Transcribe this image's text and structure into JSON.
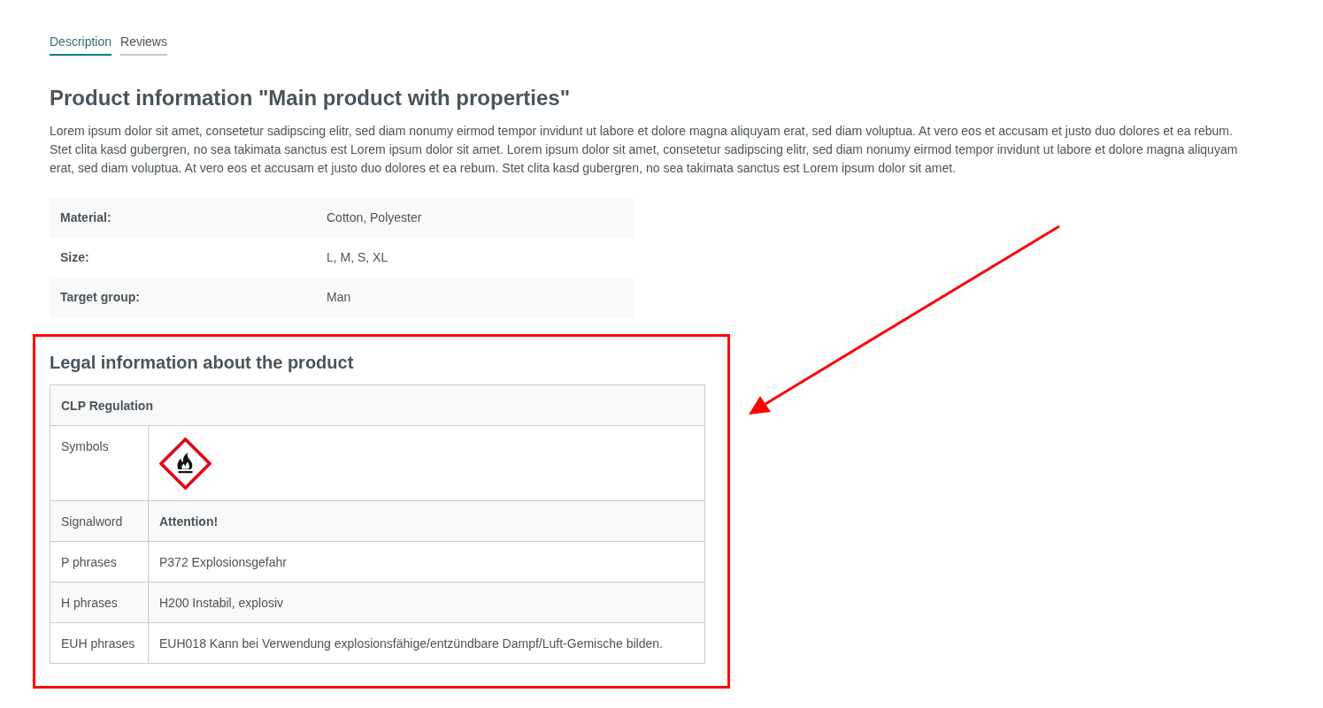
{
  "tabs": [
    {
      "label": "Description",
      "selected": true
    },
    {
      "label": "Reviews",
      "selected": false
    }
  ],
  "product_information": {
    "title": "Product information \"Main product with properties\"",
    "description": "Lorem ipsum dolor sit amet, consetetur sadipscing elitr, sed diam nonumy eirmod tempor invidunt ut labore et dolore magna aliquyam erat, sed diam voluptua. At vero eos et accusam et justo duo dolores et ea rebum. Stet clita kasd gubergren, no sea takimata sanctus est Lorem ipsum dolor sit amet. Lorem ipsum dolor sit amet, consetetur sadipscing elitr, sed diam nonumy eirmod tempor invidunt ut labore et dolore magna aliquyam erat, sed diam voluptua. At vero eos et accusam et justo duo dolores et ea rebum. Stet clita kasd gubergren, no sea takimata sanctus est Lorem ipsum dolor sit amet.",
    "properties": [
      {
        "label": "Material:",
        "value": "Cotton, Polyester"
      },
      {
        "label": "Size:",
        "value": "L, M, S, XL"
      },
      {
        "label": "Target group:",
        "value": "Man"
      }
    ]
  },
  "legal_information": {
    "title": "Legal information about the product",
    "table": {
      "heading": "CLP Regulation",
      "rows": [
        {
          "label": "Symbols",
          "kind": "pictogram"
        },
        {
          "label": "Signalword",
          "kind": "signalword",
          "value": "Attention!"
        },
        {
          "label": "P phrases",
          "kind": "text",
          "value": "P372 Explosionsgefahr"
        },
        {
          "label": "H phrases",
          "kind": "text",
          "value": "H200 Instabil, explosiv"
        },
        {
          "label": "EUH phrases",
          "kind": "text",
          "value": "EUH018 Kann bei Verwendung explosionsfähige/entzündbare Dampf/Luft-Gemische bilden."
        }
      ]
    }
  }
}
